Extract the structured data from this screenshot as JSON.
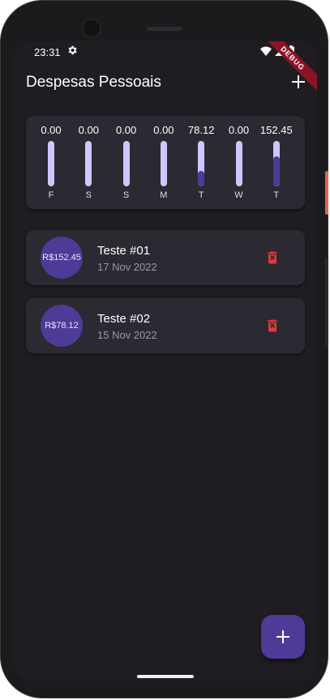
{
  "status_bar": {
    "time": "23:31"
  },
  "debug_banner": "DEBUG",
  "app_bar": {
    "title": "Despesas Pessoais"
  },
  "chart_data": {
    "type": "bar",
    "categories": [
      "F",
      "S",
      "S",
      "M",
      "T",
      "W",
      "T"
    ],
    "values": [
      0.0,
      0.0,
      0.0,
      0.0,
      78.12,
      0.0,
      152.45
    ],
    "value_labels": [
      "0.00",
      "0.00",
      "0.00",
      "0.00",
      "78.12",
      "0.00",
      "152.45"
    ],
    "fill_fraction": [
      0,
      0,
      0,
      0,
      0.339,
      0,
      0.661
    ],
    "title": "",
    "colors": {
      "track": "#cfc6ff",
      "fill": "#4e3a97"
    }
  },
  "transactions": [
    {
      "amount": "R$152.45",
      "title": "Teste #01",
      "date": "17 Nov 2022"
    },
    {
      "amount": "R$78.12",
      "title": "Teste #02",
      "date": "15 Nov 2022"
    }
  ],
  "colors": {
    "accent": "#4e3a97",
    "delete": "#e53935",
    "background": "#1f1d21",
    "card": "#2b2931"
  },
  "icons": {
    "settings": "gear-icon",
    "add": "plus-icon",
    "delete": "trash-icon"
  }
}
